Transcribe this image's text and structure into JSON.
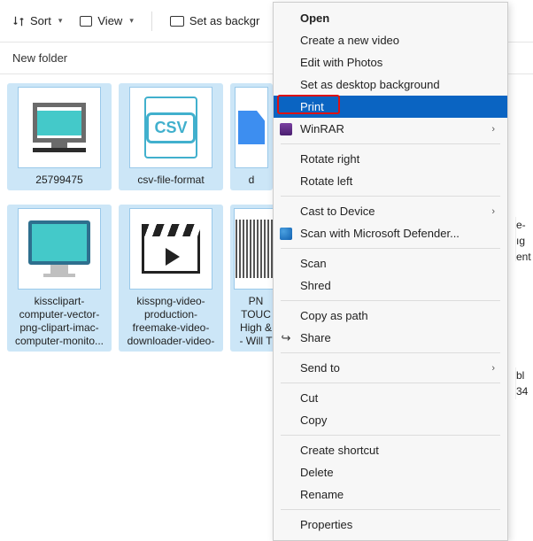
{
  "toolbar": {
    "sort": "Sort",
    "view": "View",
    "setbg": "Set as backgr"
  },
  "newfolder": "New folder",
  "items": [
    {
      "name": "25799475"
    },
    {
      "name": "csv-file-format"
    },
    {
      "name": "d"
    },
    {
      "name": "kissclipart-computer-vector-png-clipart-imac-computer-monito..."
    },
    {
      "name": "kisspng-video-production-freemake-video-downloader-video-ico..."
    },
    {
      "name": "PN\nTOUC\nHigh &\n- Will T"
    }
  ],
  "partial_right": [
    {
      "a": "e-",
      "b": "ıg",
      "c": "ent"
    },
    {
      "a": "bl",
      "b": "34"
    }
  ],
  "ctx": {
    "open": "Open",
    "newvideo": "Create a new video",
    "editphotos": "Edit with Photos",
    "setdesk": "Set as desktop background",
    "print": "Print",
    "winrar": "WinRAR",
    "rotr": "Rotate right",
    "rotl": "Rotate left",
    "cast": "Cast to Device",
    "defender": "Scan with Microsoft Defender...",
    "scan": "Scan",
    "shred": "Shred",
    "copypath": "Copy as path",
    "share": "Share",
    "sendto": "Send to",
    "cut": "Cut",
    "copy": "Copy",
    "shortcut": "Create shortcut",
    "delete": "Delete",
    "rename": "Rename",
    "properties": "Properties"
  }
}
